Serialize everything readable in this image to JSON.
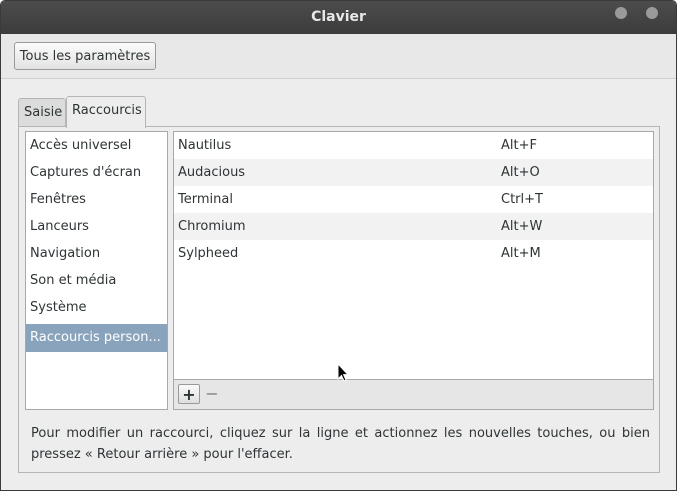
{
  "window": {
    "title": "Clavier"
  },
  "toolbar": {
    "all_settings_label": "Tous les paramètres"
  },
  "tabs": [
    {
      "label": "Saisie",
      "active": false
    },
    {
      "label": "Raccourcis",
      "active": true
    }
  ],
  "categories": [
    "Accès universel",
    "Captures d'écran",
    "Fenêtres",
    "Lanceurs",
    "Navigation",
    "Son et média",
    "Système",
    "Raccourcis person..."
  ],
  "selected_category": "Raccourcis person...",
  "shortcuts": [
    {
      "name": "Nautilus",
      "key": "Alt+F"
    },
    {
      "name": "Audacious",
      "key": "Alt+O"
    },
    {
      "name": "Terminal",
      "key": "Ctrl+T"
    },
    {
      "name": "Chromium",
      "key": "Alt+W"
    },
    {
      "name": "Sylpheed",
      "key": "Alt+M"
    }
  ],
  "buttons": {
    "add": "+",
    "remove": "−"
  },
  "hint": "Pour modifier un raccourci, cliquez sur la ligne et actionnez les nouvelles touches, ou bien pressez « Retour arrière » pour l'effacer.",
  "colors": {
    "selection": "#8aa3bd",
    "titlebar": "#3c3c3c"
  }
}
